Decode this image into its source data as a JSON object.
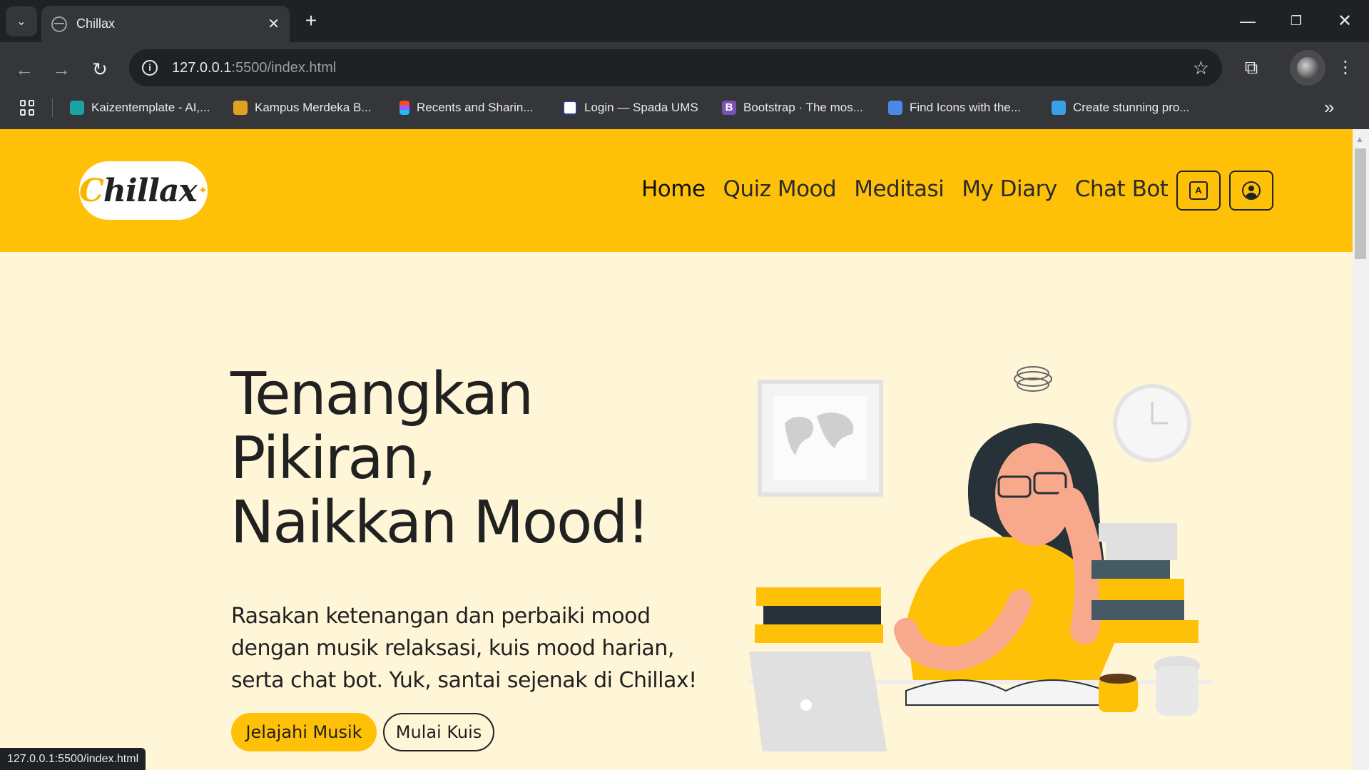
{
  "browser": {
    "tab_title": "Chillax",
    "tab_close": "✕",
    "new_tab": "+",
    "url_host": "127.0.0.1",
    "url_path": ":5500/index.html",
    "status_url": "127.0.0.1:5500/index.html",
    "window_controls": {
      "minimize": "—",
      "maximize": "❐",
      "close": "✕"
    }
  },
  "bookmarks": [
    {
      "label": "Kaizentemplate - AI,...",
      "icon": "kaizen-icon",
      "color": "#1aa3a3"
    },
    {
      "label": "Kampus Merdeka B...",
      "icon": "graduation-cap-icon",
      "color": "#e0a020"
    },
    {
      "label": "Recents and Sharin...",
      "icon": "figma-icon",
      "color": "#f24e1e"
    },
    {
      "label": "Login — Spada UMS",
      "icon": "spada-icon",
      "color": "#ffffff"
    },
    {
      "label": "Bootstrap · The mos...",
      "icon": "bootstrap-icon",
      "color": "#7952b3"
    },
    {
      "label": "Find Icons with the...",
      "icon": "flag-icon",
      "color": "#4a8ae6"
    },
    {
      "label": "Create stunning pro...",
      "icon": "layers-icon",
      "color": "#3aa0e8"
    }
  ],
  "site": {
    "logo_text_c": "C",
    "logo_text_rest": "hillax",
    "nav": [
      {
        "label": "Home",
        "active": true
      },
      {
        "label": "Quiz Mood",
        "active": false
      },
      {
        "label": "Meditasi",
        "active": false
      },
      {
        "label": "My Diary",
        "active": false
      },
      {
        "label": "Chat Bot",
        "active": false
      }
    ],
    "translate_icon_glyph": "A",
    "colors": {
      "brand_yellow": "#ffc107",
      "hero_bg": "#fff6d8",
      "text_dark": "#212121"
    }
  },
  "hero": {
    "title_line1": "Tenangkan",
    "title_line2": "Pikiran,",
    "title_line3": "Naikkan Mood!",
    "description": "Rasakan ketenangan dan perbaiki mood dengan musik relaksasi, kuis mood harian, serta chat bot. Yuk, santai sejenak di Chillax!",
    "primary_button": "Jelajahi Musik",
    "secondary_button": "Mulai Kuis"
  }
}
